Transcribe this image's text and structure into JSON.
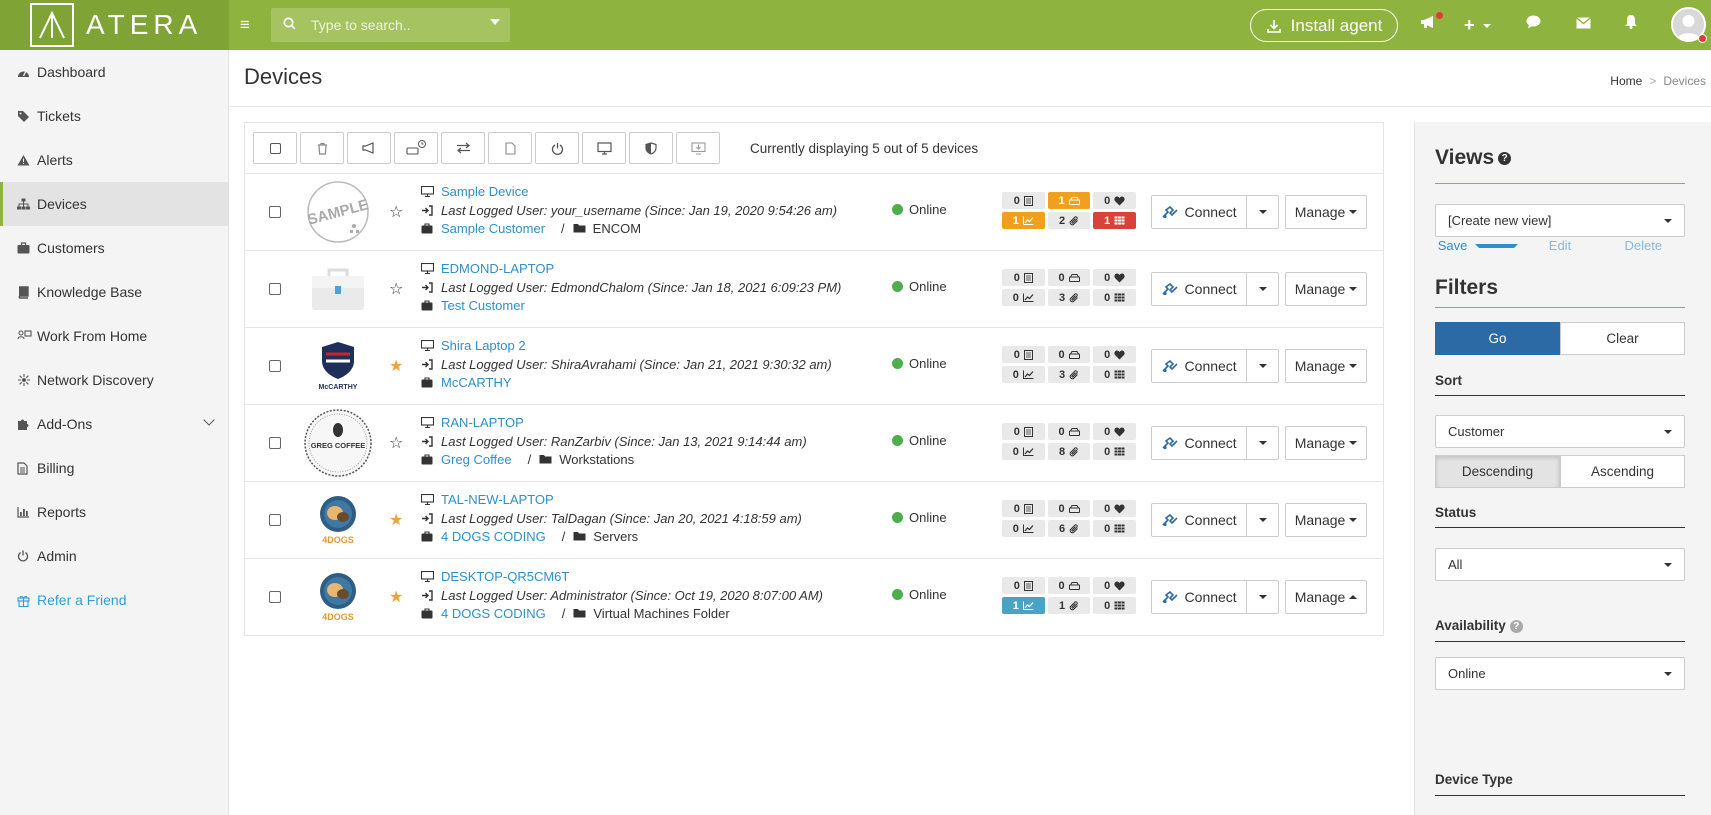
{
  "app": {
    "logo_text": "ATERA"
  },
  "topbar": {
    "search_placeholder": "Type to search..",
    "install_label": "Install agent"
  },
  "sidebar": {
    "items": [
      {
        "label": "Dashboard",
        "icon": "dashboard-icon"
      },
      {
        "label": "Tickets",
        "icon": "tags-icon"
      },
      {
        "label": "Alerts",
        "icon": "warning-icon"
      },
      {
        "label": "Devices",
        "icon": "sitemap-icon",
        "active": true
      },
      {
        "label": "Customers",
        "icon": "briefcase-icon"
      },
      {
        "label": "Knowledge Base",
        "icon": "book-icon"
      },
      {
        "label": "Work From Home",
        "icon": "remote-icon"
      },
      {
        "label": "Network Discovery",
        "icon": "network-icon"
      },
      {
        "label": "Add-Ons",
        "icon": "puzzle-icon"
      },
      {
        "label": "Billing",
        "icon": "file-icon"
      },
      {
        "label": "Reports",
        "icon": "bar-chart-icon"
      },
      {
        "label": "Admin",
        "icon": "power-icon"
      },
      {
        "label": "Refer a Friend",
        "icon": "gift-icon"
      }
    ]
  },
  "page": {
    "title": "Devices",
    "breadcrumb": [
      "Home",
      "Devices"
    ],
    "display_text": "Currently displaying 5 out of 5 devices"
  },
  "devices": [
    {
      "name": "Sample Device",
      "logged": "Last Logged User: your_username (Since: Jan 19, 2020 9:54:26 am)",
      "customer": "Sample Customer",
      "folder": "ENCOM",
      "starred": false,
      "status": "Online",
      "badges": [
        [
          "0",
          "1",
          "0"
        ],
        [
          "1",
          "2",
          "1"
        ]
      ],
      "badge_colors": [
        [
          "",
          "orange",
          ""
        ],
        [
          "orange",
          "",
          "red"
        ]
      ],
      "manage_open": false,
      "thumb": "sample"
    },
    {
      "name": "EDMOND-LAPTOP",
      "logged": "Last Logged User: EdmondChalom (Since: Jan 18, 2021 6:09:23 PM)",
      "customer": "Test Customer",
      "folder": "",
      "starred": false,
      "status": "Online",
      "badges": [
        [
          "0",
          "0",
          "0"
        ],
        [
          "0",
          "3",
          "0"
        ]
      ],
      "badge_colors": [
        [
          "",
          "",
          ""
        ],
        [
          "",
          "",
          ""
        ]
      ],
      "manage_open": false,
      "thumb": "toolbox"
    },
    {
      "name": "Shira Laptop 2",
      "logged": "Last Logged User: ShiraAvrahami (Since: Jan 21, 2021 9:30:32 am)",
      "customer": "McCARTHY",
      "folder": "",
      "starred": true,
      "status": "Online",
      "badges": [
        [
          "0",
          "0",
          "0"
        ],
        [
          "0",
          "3",
          "0"
        ]
      ],
      "badge_colors": [
        [
          "",
          "",
          ""
        ],
        [
          "",
          "",
          ""
        ]
      ],
      "manage_open": false,
      "thumb": "mccarthy",
      "thumb_text": "McCARTHY"
    },
    {
      "name": "RAN-LAPTOP",
      "logged": "Last Logged User: RanZarbiv (Since: Jan 13, 2021 9:14:44 am)",
      "customer": "Greg Coffee",
      "folder": "Workstations",
      "starred": false,
      "status": "Online",
      "badges": [
        [
          "0",
          "0",
          "0"
        ],
        [
          "0",
          "8",
          "0"
        ]
      ],
      "badge_colors": [
        [
          "",
          "",
          ""
        ],
        [
          "",
          "",
          ""
        ]
      ],
      "manage_open": false,
      "thumb": "coffee",
      "thumb_text": "GREG COFFEE"
    },
    {
      "name": "TAL-NEW-LAPTOP",
      "logged": "Last Logged User: TalDagan (Since: Jan 20, 2021 4:18:59 am)",
      "customer": "4 DOGS CODING",
      "folder": "Servers",
      "starred": true,
      "status": "Online",
      "badges": [
        [
          "0",
          "0",
          "0"
        ],
        [
          "0",
          "6",
          "0"
        ]
      ],
      "badge_colors": [
        [
          "",
          "",
          ""
        ],
        [
          "",
          "",
          ""
        ]
      ],
      "manage_open": false,
      "thumb": "dogs",
      "thumb_text": "4DOGS"
    },
    {
      "name": "DESKTOP-QR5CM6T",
      "logged": "Last Logged User: Administrator (Since: Oct 19, 2020 8:07:00 AM)",
      "customer": "4 DOGS CODING",
      "folder": "Virtual Machines Folder",
      "starred": true,
      "status": "Online",
      "badges": [
        [
          "0",
          "0",
          "0"
        ],
        [
          "1",
          "1",
          "0"
        ]
      ],
      "badge_colors": [
        [
          "",
          "",
          ""
        ],
        [
          "blue",
          "",
          ""
        ]
      ],
      "manage_open": true,
      "thumb": "dogs",
      "thumb_text": "4DOGS"
    }
  ],
  "labels": {
    "connect": "Connect",
    "manage": "Manage"
  },
  "views": {
    "title": "Views",
    "selected": "[Create new view]",
    "save": "Save",
    "edit": "Edit",
    "delete": "Delete"
  },
  "filters": {
    "title": "Filters",
    "go": "Go",
    "clear": "Clear",
    "sort_label": "Sort",
    "sort_value": "Customer",
    "descending": "Descending",
    "ascending": "Ascending",
    "status_label": "Status",
    "status_value": "All",
    "availability_label": "Availability",
    "availability_value": "Online",
    "device_type_label": "Device Type"
  },
  "colors": {
    "brand_green": "#8fb33f",
    "link_blue": "#2e8fc9",
    "go_blue": "#2c6aa6",
    "online_green": "#4cae4c"
  }
}
